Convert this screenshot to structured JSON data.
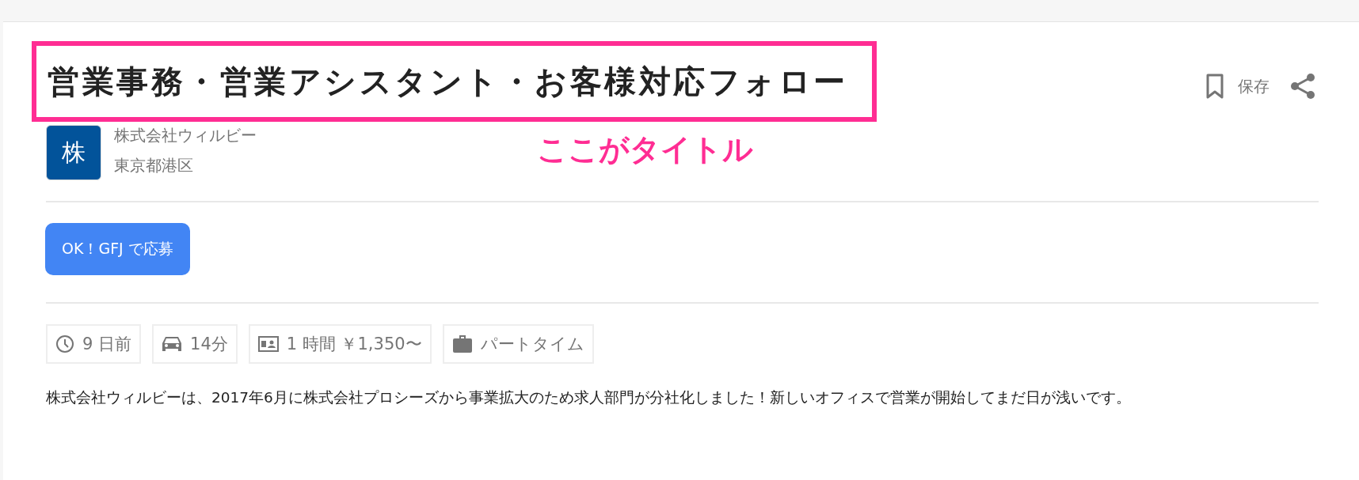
{
  "job": {
    "title": "営業事務・営業アシスタント・お客様対応フォロー"
  },
  "annotation": {
    "text": "ここがタイトル"
  },
  "actions": [
    {
      "kind": "save",
      "label": "保存"
    },
    {
      "kind": "share"
    }
  ],
  "company": {
    "logo_text": "株",
    "name": "株式会社ウィルビー",
    "location": "東京都港区"
  },
  "apply_button": {
    "label": "OK！GFJ で応募"
  },
  "chips": [
    {
      "kind": "posted",
      "text": "9 日前"
    },
    {
      "kind": "commute",
      "text": "14分"
    },
    {
      "kind": "salary",
      "text": "1 時間 ￥1,350〜"
    },
    {
      "kind": "employment",
      "text": "パートタイム"
    }
  ],
  "description": "株式会社ウィルビーは、2017年6月に株式会社プロシーズから事業拡大のため求人部門が分社化しました！新しいオフィスで営業が開始してまだ日が浅いです。"
}
